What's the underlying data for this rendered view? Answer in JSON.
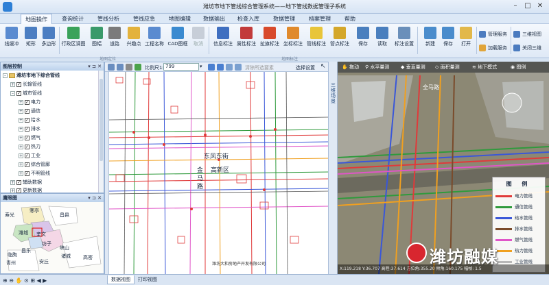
{
  "window": {
    "title": "潍坊市地下管线综合管理系统——地下管线数据管理子系统"
  },
  "menu": [
    "地图操作",
    "查询统计",
    "管线分析",
    "管线应急",
    "地图编辑",
    "数据输出",
    "检查入库",
    "数据管理",
    "档案管理",
    "帮助"
  ],
  "ribbon": {
    "main": [
      "线缓冲",
      "矩形",
      "多边形",
      "行政区调图",
      "图幅",
      "道路",
      "兴趣点",
      "工程名称",
      "CAD图框",
      "取消",
      "信息标注",
      "属性标注",
      "扯旗标注",
      "坐标标注",
      "管线标注",
      "管点标注",
      "保存",
      "读取",
      "标注设置",
      "新建",
      "保存",
      "打开"
    ],
    "side": [
      "管理服务",
      "加载服务",
      "三维视图",
      "关闭三维"
    ],
    "group_labels": [
      "地图定位",
      "地图标注"
    ]
  },
  "layer_panel": {
    "title": "图层控制",
    "root": "潍坊市地下综合管线",
    "items": [
      "长输管线",
      "城市管线",
      "电力",
      "通信",
      "给水",
      "排水",
      "燃气",
      "热力",
      "工业",
      "综合管廊",
      "不明管线",
      "辅助数据",
      "更新数据"
    ]
  },
  "eagle_panel": {
    "title": "鹰眼图",
    "places": [
      "寿光",
      "寒亭",
      "昌邑",
      "坊子",
      "奎文",
      "潍城",
      "临朐",
      "昌乐",
      "安丘",
      "诸城",
      "高密",
      "峡山",
      "青州"
    ]
  },
  "map_toolbar": {
    "scale_label": "比例尺1:",
    "scale_value": "799",
    "clear_label": "清除所选要素",
    "settings": "选择设置"
  },
  "map2d": {
    "street_east": "东风东街",
    "district": "高新区",
    "road_v1": "金",
    "road_v2": "马",
    "road_v3": "路",
    "footer": "潍坊大和房地产开发有限公司"
  },
  "bottom_tabs": [
    "数据视图",
    "打印视图"
  ],
  "vstrip_label": "三维场景",
  "scene3d": {
    "tools": [
      "拖动",
      "水平量测",
      "垂直量测",
      "面积量测",
      "地下模式",
      "图例"
    ],
    "poi": "全马路",
    "status": "X:119.218 Y:36.707 高程:37.614 方位角:355.20 倾角:160.175 幅帧: 1.5",
    "watermark": "潍坊融媒"
  },
  "legend": {
    "title": "图 例",
    "items": [
      {
        "label": "电力管线",
        "color": "#e03a3a"
      },
      {
        "label": "通信管线",
        "color": "#2f9a3c"
      },
      {
        "label": "给水管线",
        "color": "#3a57d8"
      },
      {
        "label": "排水管线",
        "color": "#7a4b2b"
      },
      {
        "label": "燃气管线",
        "color": "#e055c8"
      },
      {
        "label": "热力管线",
        "color": "#f0a020"
      },
      {
        "label": "工业管线",
        "color": "#b8b8b8"
      }
    ]
  }
}
